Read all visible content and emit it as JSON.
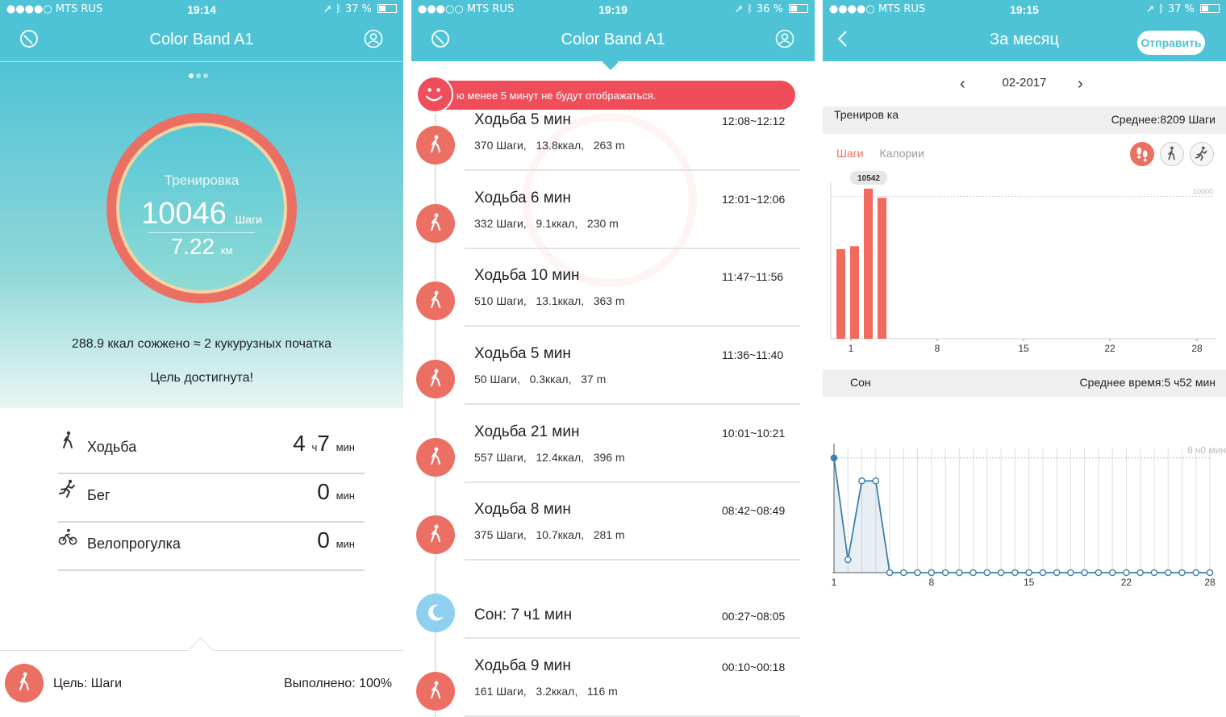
{
  "status": [
    {
      "carrier": "●●●●○ MTS RUS",
      "time": "19:14",
      "battery": "37 %",
      "battery_level": 0.37
    },
    {
      "carrier": "●●●○○ MTS RUS",
      "time": "19:19",
      "battery": "36 %",
      "battery_level": 0.36
    },
    {
      "carrier": "●●●●○ MTS RUS",
      "time": "19:15",
      "battery": "37 %",
      "battery_level": 0.37
    }
  ],
  "screen1": {
    "title": "Color Band A1",
    "ring_label": "Тренировка",
    "steps": "10046",
    "steps_unit": "Шаги",
    "distance": "7.22",
    "distance_unit": "км",
    "kcal_text": "288.9 ккал сожжено ≈ 2 кукурузных початка",
    "goal_reached": "Цель достигнута!",
    "activities": [
      {
        "name": "Ходьба",
        "value": "4",
        "unit1": "ч",
        "value2": "7",
        "unit2": "мин"
      },
      {
        "name": "Бег",
        "value": "0",
        "unit2": "мин"
      },
      {
        "name": "Велопрогулка",
        "value": "0",
        "unit2": "мин"
      }
    ],
    "footer_goal": "Цель: Шаги",
    "footer_done": "Выполнено: 100%"
  },
  "screen2": {
    "title": "Color Band A1",
    "banner": "ю менее 5 минут не будут отображаться.",
    "events": [
      {
        "name": "Ходьба 5 мин",
        "time": "12:08~12:12",
        "steps": "370 Шаги,",
        "kcal": "13.8ккал,",
        "dist": "263 m"
      },
      {
        "name": "Ходьба 6 мин",
        "time": "12:01~12:06",
        "steps": "332 Шаги,",
        "kcal": "9.1ккал,",
        "dist": "230 m"
      },
      {
        "name": "Ходьба 10 мин",
        "time": "11:47~11:56",
        "steps": "510 Шаги,",
        "kcal": "13.1ккал,",
        "dist": "363 m"
      },
      {
        "name": "Ходьба 5 мин",
        "time": "11:36~11:40",
        "steps": "50 Шаги,",
        "kcal": "0.3ккал,",
        "dist": "37 m"
      },
      {
        "name": "Ходьба 21 мин",
        "time": "10:01~10:21",
        "steps": "557 Шаги,",
        "kcal": "12.4ккал,",
        "dist": "396 m"
      },
      {
        "name": "Ходьба 8 мин",
        "time": "08:42~08:49",
        "steps": "375 Шаги,",
        "kcal": "10.7ккал,",
        "dist": "281 m"
      },
      {
        "name": "Сон: 7 ч1 мин",
        "time": "00:27~08:05",
        "steps": "",
        "kcal": "",
        "dist": ""
      },
      {
        "name": "Ходьба 9 мин",
        "time": "00:10~00:18",
        "steps": "161 Шаги,",
        "kcal": "3.2ккал,",
        "dist": "116 m"
      }
    ]
  },
  "screen3": {
    "title": "За месяц",
    "send": "Отправить",
    "month": "02-2017",
    "section1_left": "Трениров ка",
    "section1_right": "Среднее:8209 Шаги",
    "tab_steps": "Шаги",
    "tab_calories": "Калории",
    "section2_left": "Сон",
    "section2_right": "Среднее время:5 ч52 мин"
  },
  "chart_data": [
    {
      "type": "bar",
      "x": [
        1,
        2,
        3,
        4
      ],
      "values": [
        6300,
        6500,
        10542,
        9900
      ],
      "xticks": [
        "1",
        "8",
        "15",
        "22",
        "28"
      ],
      "annotation": "10542",
      "reference_line": {
        "value": 10000,
        "label": "10000"
      },
      "xlim": [
        1,
        28
      ],
      "ylim": [
        0,
        11500
      ],
      "color": "#f16a5d"
    },
    {
      "type": "area",
      "x": [
        1,
        2,
        3,
        4,
        5,
        6,
        7,
        8,
        9,
        10,
        11,
        12,
        13,
        14,
        15,
        16,
        17,
        18,
        19,
        20,
        21,
        22,
        23,
        24,
        25,
        26,
        27,
        28
      ],
      "values": [
        8.0,
        0.9,
        6.4,
        6.4,
        0,
        0,
        0,
        0,
        0,
        0,
        0,
        0,
        0,
        0,
        0,
        0,
        0,
        0,
        0,
        0,
        0,
        0,
        0,
        0,
        0,
        0,
        0,
        0
      ],
      "xticks": [
        "1",
        "8",
        "15",
        "22",
        "28"
      ],
      "reference_line": {
        "value": 8,
        "label": "8 ч0 мин"
      },
      "xlim": [
        1,
        28
      ],
      "ylim": [
        0,
        9
      ],
      "color": "#3f7fa8"
    }
  ]
}
